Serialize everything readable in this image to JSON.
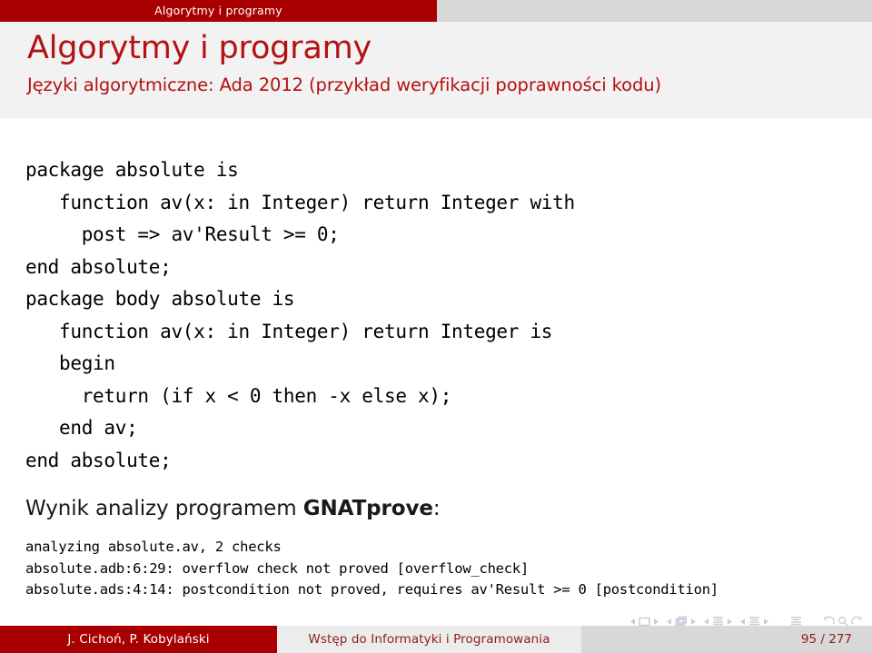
{
  "headline": {
    "section_label": "Algorytmy i programy"
  },
  "title_block": {
    "title": "Algorytmy i programy",
    "subtitle": "Języki algorytmiczne: Ada 2012 (przykład weryfikacji poprawności kodu)"
  },
  "body": {
    "code": "package absolute is\n   function av(x: in Integer) return Integer with\n     post => av'Result >= 0;\nend absolute;\npackage body absolute is\n   function av(x: in Integer) return Integer is\n   begin\n     return (if x < 0 then -x else x);\n   end av;\nend absolute;",
    "analysis_heading_prefix": "Wynik analizy programem ",
    "analysis_heading_tool": "GNATprove",
    "analysis_heading_suffix": ":",
    "output": "analyzing absolute.av, 2 checks\nabsolute.adb:6:29: overflow check not proved [overflow_check]\nabsolute.ads:4:14: postcondition not proved, requires av'Result >= 0 [postcondition]"
  },
  "nav_symbols": {
    "items": [
      "slide-prev-icon",
      "slide-icon",
      "slide-next-icon",
      "frame-prev-icon",
      "frame-icon",
      "frame-next-icon",
      "subsection-prev-icon",
      "subsection-icon",
      "subsection-next-icon",
      "section-prev-icon",
      "section-icon",
      "section-next-icon",
      "doc-icon",
      "back-icon",
      "search-icon",
      "forward-icon"
    ]
  },
  "footline": {
    "author": "J. Cichoń, P. Kobylański",
    "title": "Wstęp do Informatyki i Programowania",
    "page": "95 / 277"
  },
  "colors": {
    "brand_red": "#a80000",
    "title_red": "#b31111",
    "foot_text_red": "#8d2020",
    "bar_grey": "#d8d8d8",
    "title_bg": "#f2f2f2"
  }
}
